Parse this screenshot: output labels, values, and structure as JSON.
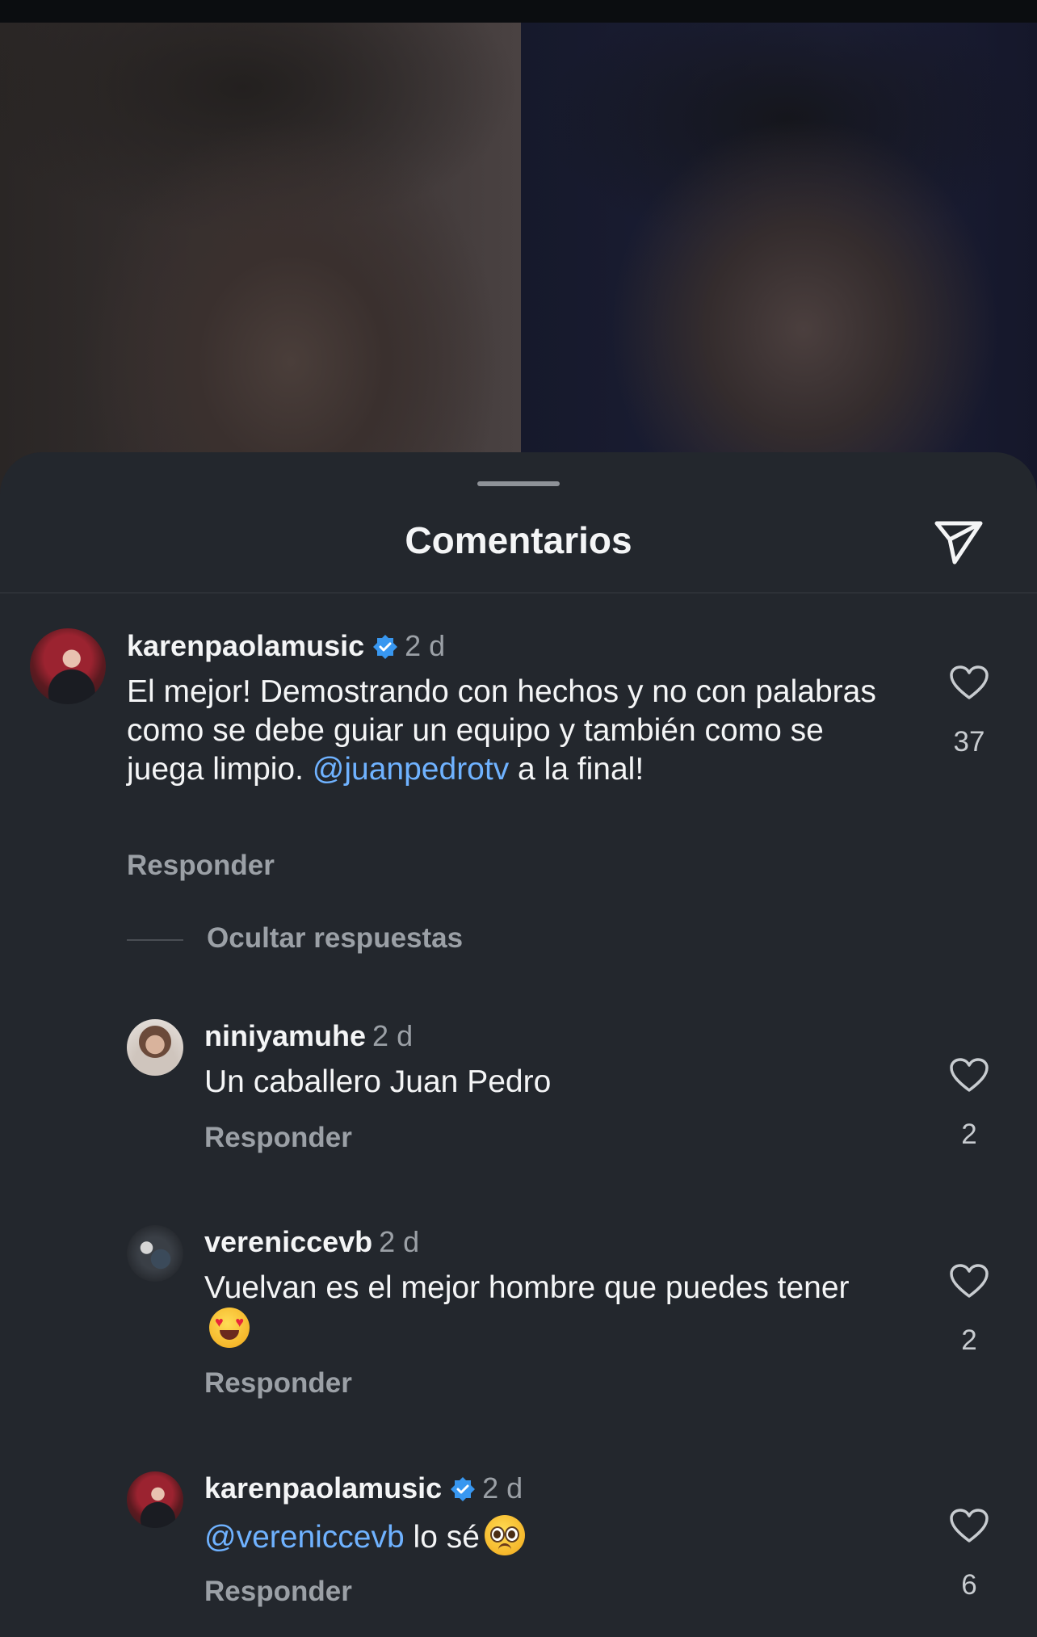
{
  "header": {
    "title": "Comentarios"
  },
  "colors": {
    "sheet_bg": "#23272d",
    "mention": "#6fb2ff",
    "verified": "#3897f0"
  },
  "comments": [
    {
      "username": "karenpaolamusic",
      "verified": true,
      "time": "2 d",
      "text_1": "El mejor! Demostrando con hechos y no con palabras como se debe guiar un equipo y también como se juega limpio. ",
      "mention": "@juanpedrotv",
      "text_2": " a la final!",
      "reply_label": "Responder",
      "likes": "37",
      "icon": "heart-icon"
    }
  ],
  "hide_replies_label": "Ocultar respuestas",
  "replies": [
    {
      "username": "niniyamuhe",
      "time": "2 d",
      "text": "Un caballero Juan Pedro",
      "reply_label": "Responder",
      "likes": "2"
    },
    {
      "username": "vereniccevb",
      "time": "2 d",
      "text": "Vuelvan es el mejor hombre que puedes tener",
      "emoji": "heart-eyes-emoji",
      "reply_label": "Responder",
      "likes": "2"
    },
    {
      "username": "karenpaolamusic",
      "verified": true,
      "time": "2 d",
      "mention": "@vereniccevb",
      "text": " lo sé",
      "emoji": "pleading-face-emoji",
      "reply_label": "Responder",
      "likes": "6"
    }
  ]
}
